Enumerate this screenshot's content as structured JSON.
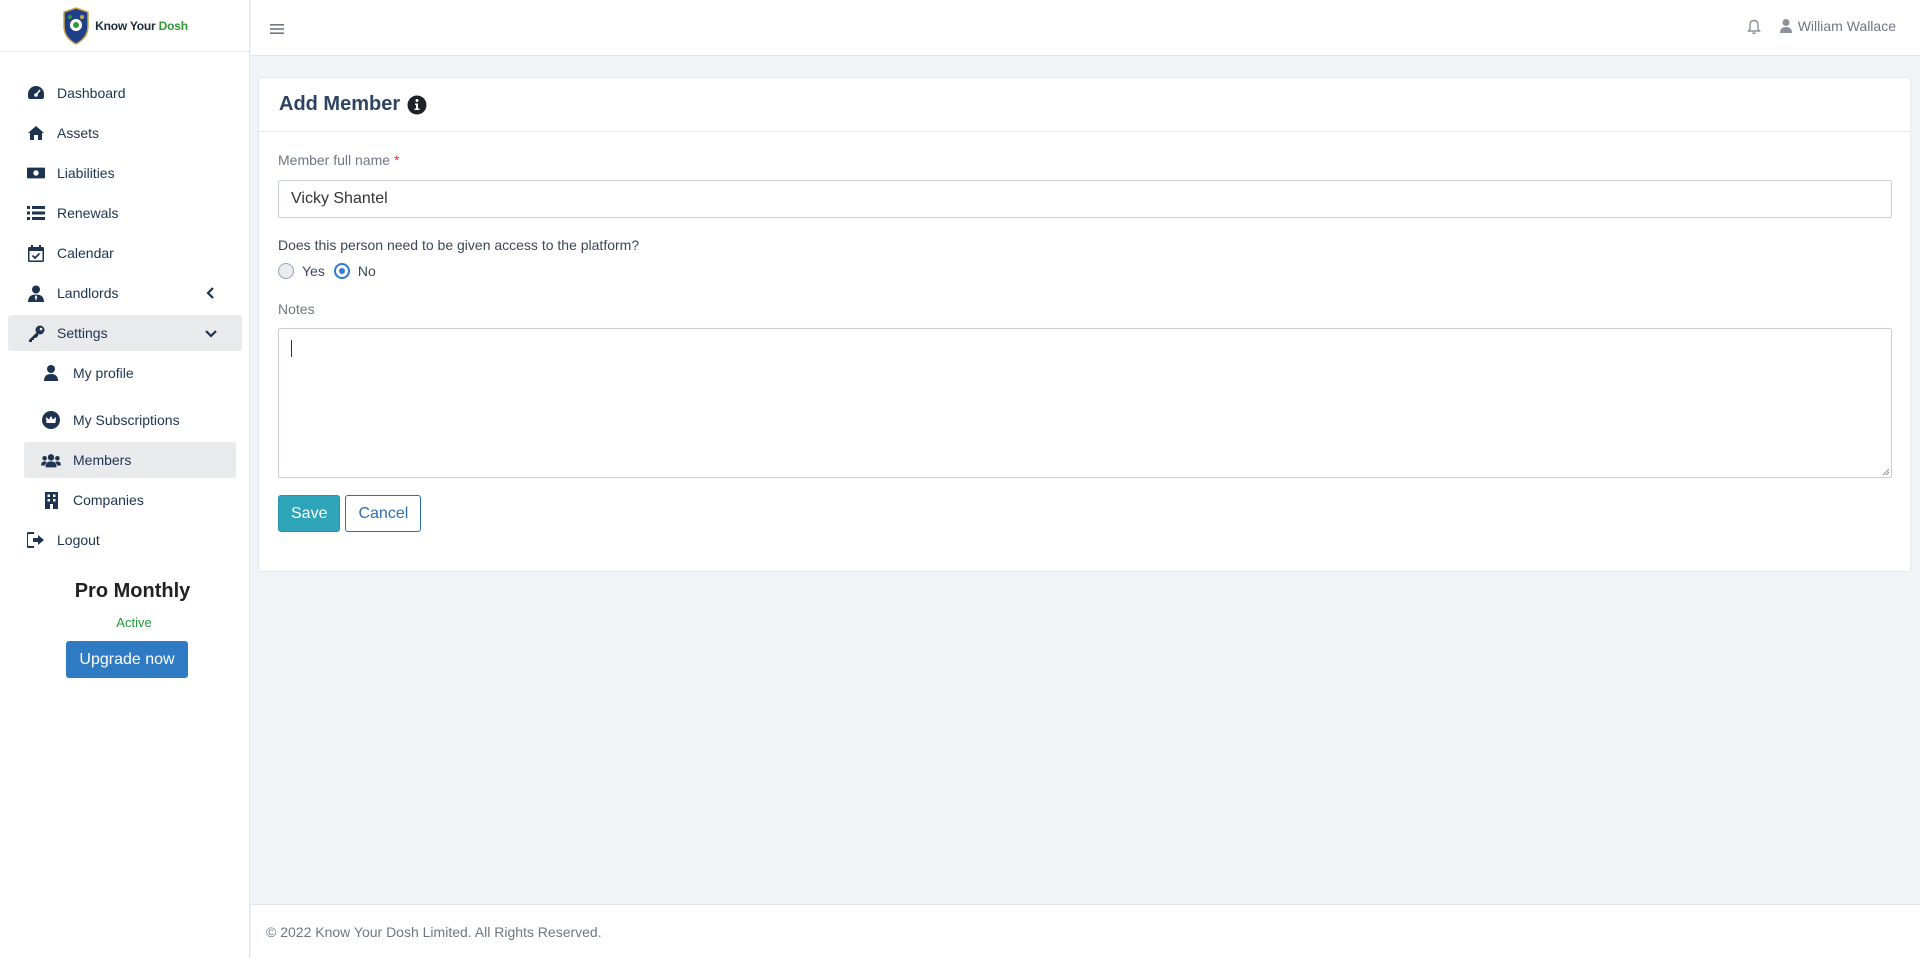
{
  "brand": {
    "name_prefix": "Know Your",
    "name_accent": "Dosh"
  },
  "sidebar": {
    "items": [
      {
        "label": "Dashboard",
        "icon": "dashboard-gauge-icon"
      },
      {
        "label": "Assets",
        "icon": "home-icon"
      },
      {
        "label": "Liabilities",
        "icon": "money-bill-icon"
      },
      {
        "label": "Renewals",
        "icon": "list-icon"
      },
      {
        "label": "Calendar",
        "icon": "calendar-check-icon"
      },
      {
        "label": "Landlords",
        "icon": "user-tie-icon"
      },
      {
        "label": "Settings",
        "icon": "key-icon"
      }
    ],
    "settings_sub": [
      {
        "label": "My profile",
        "icon": "user-icon"
      },
      {
        "label": "My Subscriptions",
        "icon": "crown-icon"
      },
      {
        "label": "Members",
        "icon": "users-icon"
      },
      {
        "label": "Companies",
        "icon": "building-icon"
      }
    ],
    "logout": {
      "label": "Logout",
      "icon": "sign-out-icon"
    }
  },
  "plan": {
    "name": "Pro Monthly",
    "status": "Active",
    "upgrade_label": "Upgrade now"
  },
  "topbar": {
    "user_name": "William Wallace"
  },
  "form": {
    "title": "Add Member",
    "name_label": "Member full name",
    "required_mark": "*",
    "name_value": "Vicky Shantel",
    "access_question": "Does this person need to be given access to the platform?",
    "yes_label": "Yes",
    "no_label": "No",
    "selected": "No",
    "notes_label": "Notes",
    "notes_value": "",
    "save_label": "Save",
    "cancel_label": "Cancel"
  },
  "footer": {
    "text": "© 2022 Know Your Dosh Limited. All Rights Reserved."
  },
  "colors": {
    "accent": "#2ea4b8",
    "upgrade": "#2e7bc4",
    "active_status": "#1e9a3a",
    "radio_checked": "#2f7ad3"
  }
}
